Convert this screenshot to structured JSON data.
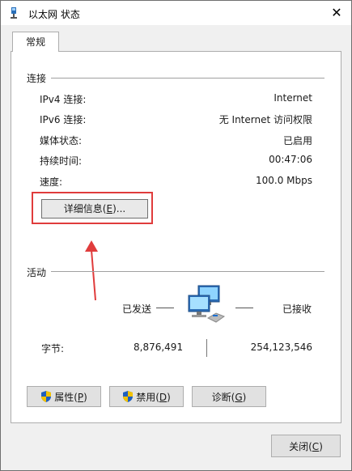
{
  "window": {
    "title": "以太网 状态",
    "close_glyph": "✕"
  },
  "tabs": [
    {
      "label": "常规"
    }
  ],
  "connection": {
    "section_title": "连接",
    "rows": [
      {
        "label": "IPv4 连接:",
        "value": "Internet"
      },
      {
        "label": "IPv6 连接:",
        "value": "无 Internet 访问权限"
      },
      {
        "label": "媒体状态:",
        "value": "已启用"
      },
      {
        "label": "持续时间:",
        "value": "00:47:06"
      },
      {
        "label": "速度:",
        "value": "100.0 Mbps"
      }
    ],
    "details_button": {
      "text": "详细信息(",
      "mnemonic": "E",
      "suffix": ")..."
    }
  },
  "activity": {
    "section_title": "活动",
    "sent_label": "已发送",
    "received_label": "已接收",
    "bytes_label": "字节:",
    "bytes_sent": "8,876,491",
    "bytes_received": "254,123,546"
  },
  "buttons": {
    "properties": {
      "text": "属性(",
      "mnemonic": "P",
      "suffix": ")"
    },
    "disable": {
      "text": "禁用(",
      "mnemonic": "D",
      "suffix": ")"
    },
    "diagnose": {
      "text": "诊断(",
      "mnemonic": "G",
      "suffix": ")"
    },
    "close": {
      "text": "关闭(",
      "mnemonic": "C",
      "suffix": ")"
    }
  },
  "colors": {
    "highlight": "#e03c3c",
    "shield_blue": "#1f5fbf",
    "shield_yellow": "#f2c200"
  },
  "icons": {
    "title": "network-icon",
    "activity": "network-computers-icon",
    "shield": "uac-shield-icon"
  }
}
